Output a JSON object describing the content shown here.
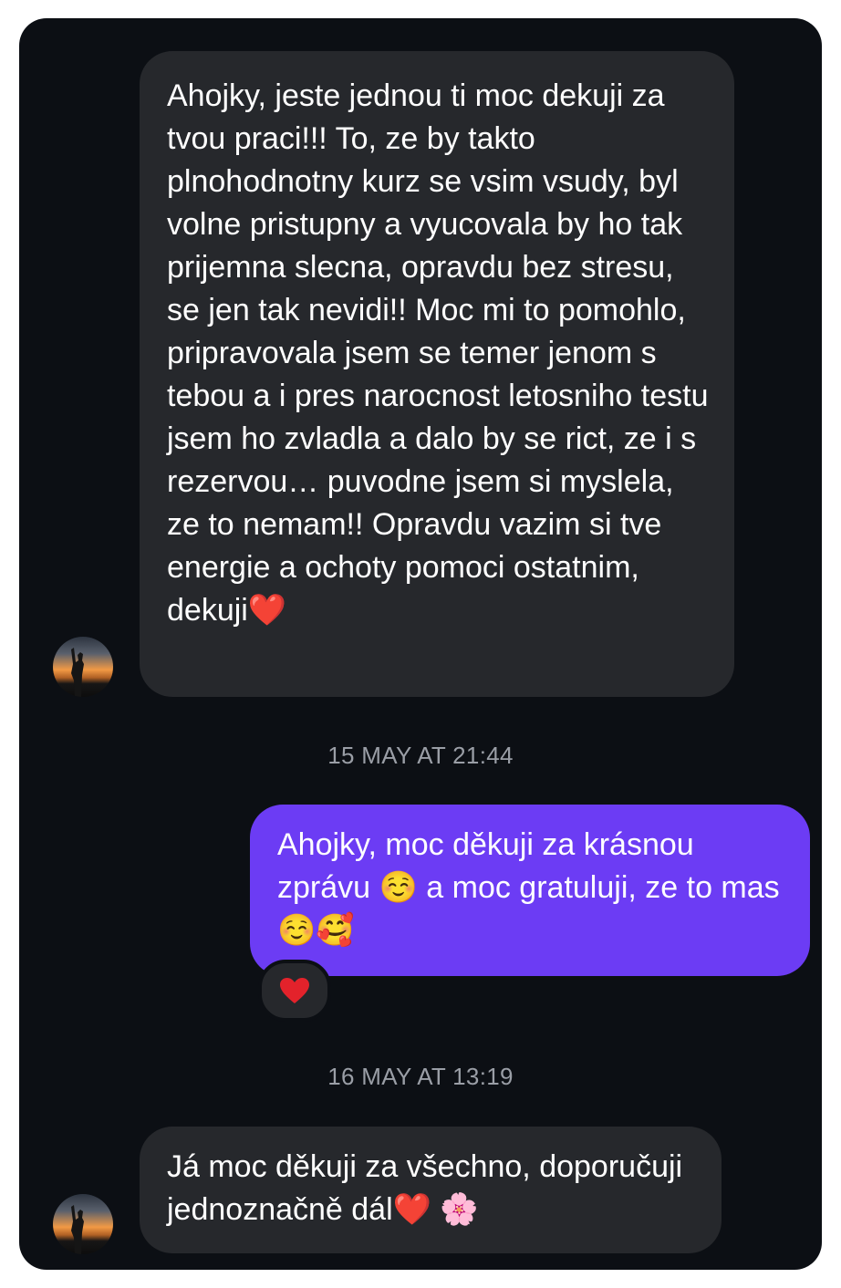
{
  "conversation": {
    "messages": [
      {
        "sender": "other",
        "text": "Ahojky, jeste jednou ti moc dekuji za tvou praci!!! To, ze by takto plnohodnotny kurz se vsim vsudy, byl volne pristupny a vyucovala by ho tak prijemna slecna, opravdu bez stresu, se jen tak nevidi!! Moc mi to pomohlo, pripravovala jsem se temer jenom s tebou a i pres narocnost letosniho testu jsem ho zvladla a dalo by se rict, ze i s rezervou… puvodne jsem si myslela, ze to nemam!! Opravdu vazim si tve energie a ochoty pomoci ostatnim, dekuji❤️"
      },
      {
        "sender": "me",
        "timestamp": "15 MAY AT 21:44",
        "text": "Ahojky, moc děkuji za krásnou zprávu ☺️ a moc gratuluji, ze to mas ☺️🥰",
        "reaction": "❤️"
      },
      {
        "sender": "other",
        "timestamp": "16 MAY AT 13:19",
        "text": "Já moc děkuji za všechno, doporučuji jednoznačně dál❤️ 🌸"
      }
    ]
  },
  "colors": {
    "background": "#0c0f14",
    "incoming_bubble": "#26282c",
    "outgoing_bubble": "#6c3cf4",
    "timestamp_text": "#9a9ea6"
  },
  "icons": {
    "avatar": "sunset-silhouette-avatar",
    "reaction": "red-heart-icon"
  }
}
